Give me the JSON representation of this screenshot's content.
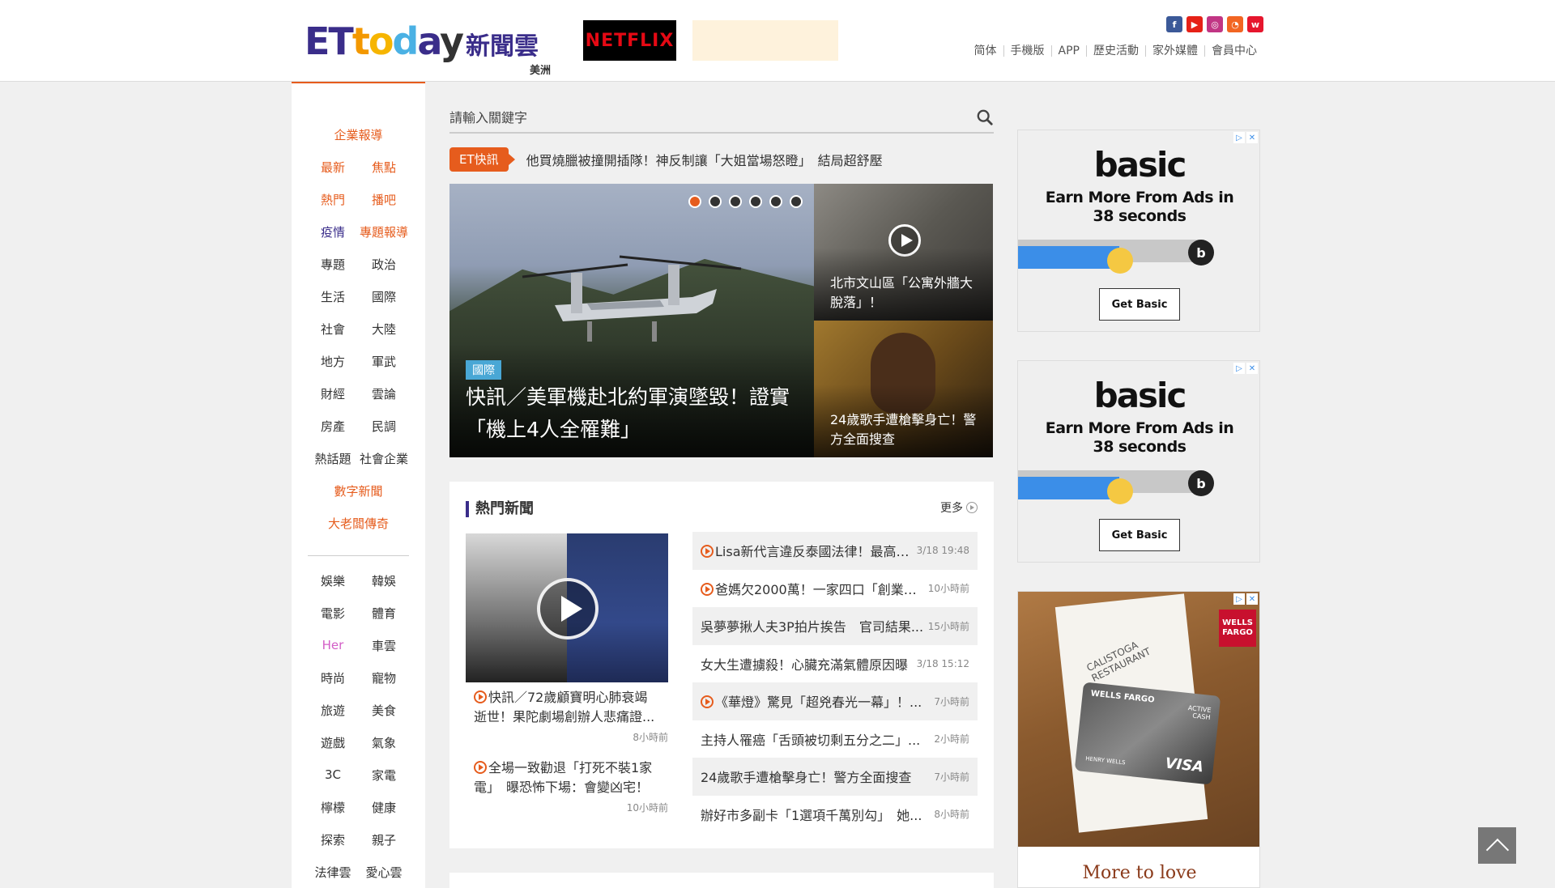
{
  "header": {
    "logo_main": "ET",
    "logo_letters": [
      "t",
      "o",
      "d",
      "a",
      "y"
    ],
    "logo_suffix": "新聞雲",
    "region": "美洲",
    "netflix_label": "NETFLIX",
    "social_icons": [
      {
        "name": "facebook-icon",
        "glyph": "f",
        "color": "#3b5998"
      },
      {
        "name": "youtube-icon",
        "glyph": "▶",
        "color": "#e62117"
      },
      {
        "name": "instagram-icon",
        "glyph": "◎",
        "color": "#c13584"
      },
      {
        "name": "rss-icon",
        "glyph": "◔",
        "color": "#f26522"
      },
      {
        "name": "weibo-icon",
        "glyph": "w",
        "color": "#e6162d"
      }
    ],
    "topnav": [
      "简体",
      "手機版",
      "APP",
      "歷史活動",
      "家外媒體",
      "會員中心"
    ]
  },
  "leftnav": {
    "accent_color": "#e65c1d",
    "rows": [
      {
        "items": [
          {
            "label": "企業報導",
            "style": "orange"
          }
        ]
      },
      {
        "items": [
          {
            "label": "最新",
            "style": "orange"
          },
          {
            "label": "焦點",
            "style": "orange"
          }
        ]
      },
      {
        "items": [
          {
            "label": "熱門",
            "style": "orange"
          },
          {
            "label": "播吧",
            "style": "orange"
          }
        ]
      },
      {
        "items": [
          {
            "label": "疫情",
            "style": "purple"
          },
          {
            "label": "專題報導",
            "style": "orange"
          }
        ]
      },
      {
        "items": [
          {
            "label": "專題",
            "style": ""
          },
          {
            "label": "政治",
            "style": ""
          }
        ]
      },
      {
        "items": [
          {
            "label": "生活",
            "style": ""
          },
          {
            "label": "國際",
            "style": ""
          }
        ]
      },
      {
        "items": [
          {
            "label": "社會",
            "style": ""
          },
          {
            "label": "大陸",
            "style": ""
          }
        ]
      },
      {
        "items": [
          {
            "label": "地方",
            "style": ""
          },
          {
            "label": "軍武",
            "style": ""
          }
        ]
      },
      {
        "items": [
          {
            "label": "財經",
            "style": ""
          },
          {
            "label": "雲論",
            "style": ""
          }
        ]
      },
      {
        "items": [
          {
            "label": "房產",
            "style": ""
          },
          {
            "label": "民調",
            "style": ""
          }
        ]
      },
      {
        "items": [
          {
            "label": "熱話題",
            "style": ""
          },
          {
            "label": "社會企業",
            "style": ""
          }
        ]
      },
      {
        "items": [
          {
            "label": "數字新聞",
            "style": "orange"
          }
        ]
      },
      {
        "items": [
          {
            "label": "大老闆傳奇",
            "style": "orange"
          }
        ]
      }
    ],
    "rows2": [
      {
        "items": [
          {
            "label": "娛樂",
            "style": ""
          },
          {
            "label": "韓娛",
            "style": ""
          }
        ]
      },
      {
        "items": [
          {
            "label": "電影",
            "style": ""
          },
          {
            "label": "體育",
            "style": ""
          }
        ]
      },
      {
        "items": [
          {
            "label": "Her",
            "style": "pink"
          },
          {
            "label": "車雲",
            "style": ""
          }
        ]
      },
      {
        "items": [
          {
            "label": "時尚",
            "style": ""
          },
          {
            "label": "寵物",
            "style": ""
          }
        ]
      },
      {
        "items": [
          {
            "label": "旅遊",
            "style": ""
          },
          {
            "label": "美食",
            "style": ""
          }
        ]
      },
      {
        "items": [
          {
            "label": "遊戲",
            "style": ""
          },
          {
            "label": "氣象",
            "style": ""
          }
        ]
      },
      {
        "items": [
          {
            "label": "3C",
            "style": ""
          },
          {
            "label": "家電",
            "style": ""
          }
        ]
      },
      {
        "items": [
          {
            "label": "檸檬",
            "style": ""
          },
          {
            "label": "健康",
            "style": ""
          }
        ]
      },
      {
        "items": [
          {
            "label": "探索",
            "style": ""
          },
          {
            "label": "親子",
            "style": ""
          }
        ]
      },
      {
        "items": [
          {
            "label": "法律雲",
            "style": ""
          },
          {
            "label": "愛心雲",
            "style": ""
          }
        ]
      }
    ]
  },
  "search": {
    "placeholder": "請輸入關鍵字"
  },
  "flash": {
    "tag": "ET快訊",
    "text": "他買燒臘被撞開插隊！神反制讓「大姐當場怒瞪」　結局超舒壓"
  },
  "hero": {
    "category": "國際",
    "title": "快訊／美軍機赴北約軍演墜毀！證實「機上4人全罹難」",
    "slides": 6,
    "active_slide": 1
  },
  "side_items": [
    {
      "title": "北市文山區「公寓外牆大脫落」！",
      "has_video": true
    },
    {
      "title": "24歲歌手遭槍擊身亡！警方全面搜查",
      "has_video": false
    }
  ],
  "hot": {
    "heading": "熱門新聞",
    "more": "更多",
    "left_items": [
      {
        "title": "快訊／72歲顧寶明心肺衰竭逝世！果陀劇場創辦人悲痛證...",
        "time": "8小時前",
        "video": true
      },
      {
        "title": "全場一致勸退「打死不裝1家電」　曝恐怖下場：會變凶宅！",
        "time": "10小時前",
        "video": true
      }
    ],
    "list": [
      {
        "title": "Lisa新代言違反泰國法律！最高「...",
        "time": "3/18 19:48",
        "video": true
      },
      {
        "title": "爸媽欠2000萬！一家四口「創業賣...",
        "time": "10小時前",
        "video": true
      },
      {
        "title": "吳夢夢揪人夫3P拍片挨告　官司結果...",
        "time": "15小時前",
        "video": false
      },
      {
        "title": "女大生遭擄殺！心臟充滿氣體原因曝",
        "time": "3/18 15:12",
        "video": false
      },
      {
        "title": "《華燈》驚見「超兇春光一幕」！...",
        "time": "7小時前",
        "video": true
      },
      {
        "title": "主持人罹癌「舌頭被切剩五分之二」...",
        "time": "2小時前",
        "video": false
      },
      {
        "title": "24歲歌手遭槍擊身亡！警方全面搜查",
        "time": "7小時前",
        "video": false
      },
      {
        "title": "辦好市多副卡「1選項千萬別勾」　她...",
        "time": "8小時前",
        "video": false
      }
    ]
  },
  "ads": {
    "basic": {
      "brand": "basic",
      "copy_line1": "Earn More From Ads in",
      "copy_line2": "38 seconds",
      "button": "Get Basic",
      "icon": "b",
      "progress": 0.55
    },
    "wells": {
      "logo_line1": "WELLS",
      "logo_line2": "FARGO",
      "receipt": "CALISTOGA RESTAURANT",
      "card_brand": "WELLS FARGO",
      "card_tag1": "ACTIVE",
      "card_tag2": "CASH",
      "card_holder": "HENRY WELLS",
      "card_network": "VISA",
      "tagline": "More to love"
    },
    "ad_marker": "▷",
    "ad_close": "✕"
  }
}
